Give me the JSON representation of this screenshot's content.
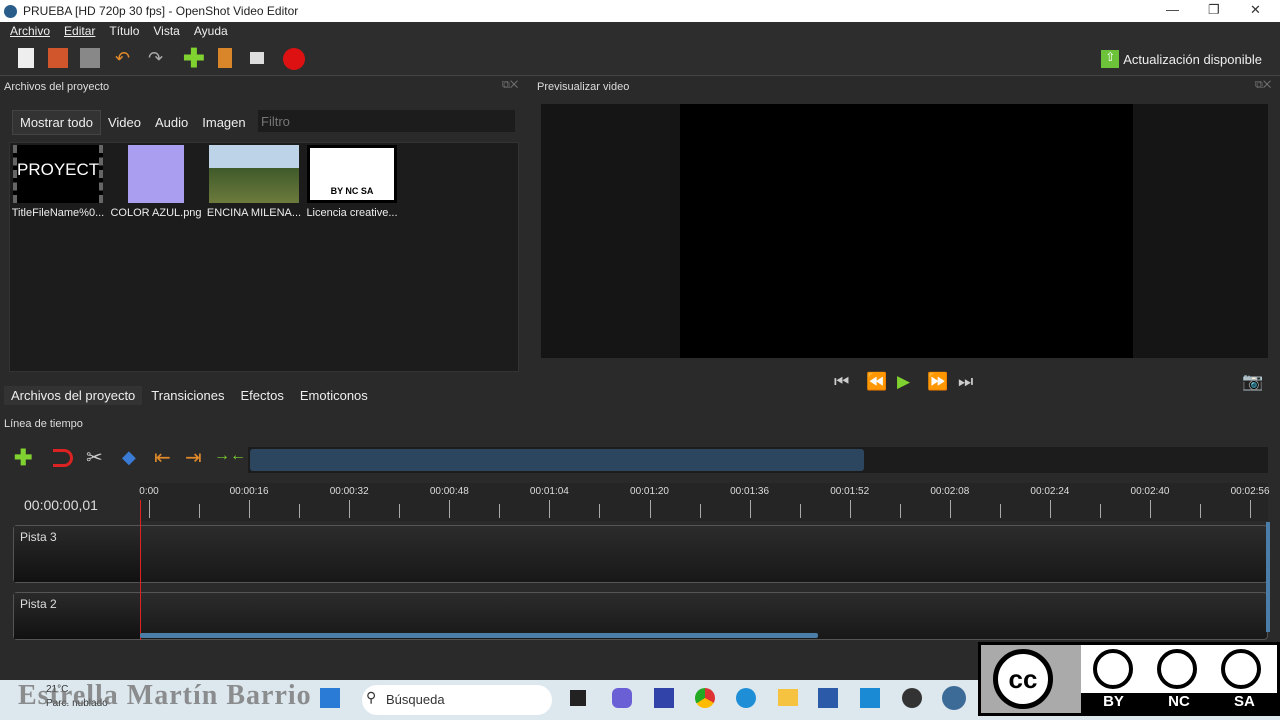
{
  "window": {
    "title": "PRUEBA [HD 720p 30 fps] - OpenShot Video Editor"
  },
  "menu": [
    "Archivo",
    "Editar",
    "Título",
    "Vista",
    "Ayuda"
  ],
  "toolbar": {
    "update": "Actualización disponible"
  },
  "project_panel": {
    "title": "Archivos del proyecto",
    "tabs": [
      "Mostrar todo",
      "Video",
      "Audio",
      "Imagen"
    ],
    "filter_placeholder": "Filtro",
    "files": [
      {
        "name": "TitleFileName%0...",
        "thumb_text": "PROYECT"
      },
      {
        "name": "COLOR AZUL.png"
      },
      {
        "name": "ENCINA MILENA..."
      },
      {
        "name": "Licencia creative...",
        "thumb_text": "BY NC SA"
      }
    ]
  },
  "preview_panel": {
    "title": "Previsualizar video"
  },
  "bottom_tabs": [
    "Archivos del proyecto",
    "Transiciones",
    "Efectos",
    "Emoticonos"
  ],
  "timeline": {
    "title": "Línea de tiempo",
    "current_time": "00:00:00,01",
    "ruler": [
      "0:00",
      "00:00:16",
      "00:00:32",
      "00:00:48",
      "00:01:04",
      "00:01:20",
      "00:01:36",
      "00:01:52",
      "00:02:08",
      "00:02:24",
      "00:02:40",
      "00:02:56"
    ],
    "tracks": [
      "Pista 3",
      "Pista 2"
    ]
  },
  "taskbar": {
    "weather_temp": "21°C",
    "weather_desc": "Parc. nublado",
    "search": "Búsqueda",
    "watermark": "Estrella Martín Barrio"
  },
  "license": {
    "labels": [
      "BY",
      "NC",
      "SA"
    ]
  }
}
